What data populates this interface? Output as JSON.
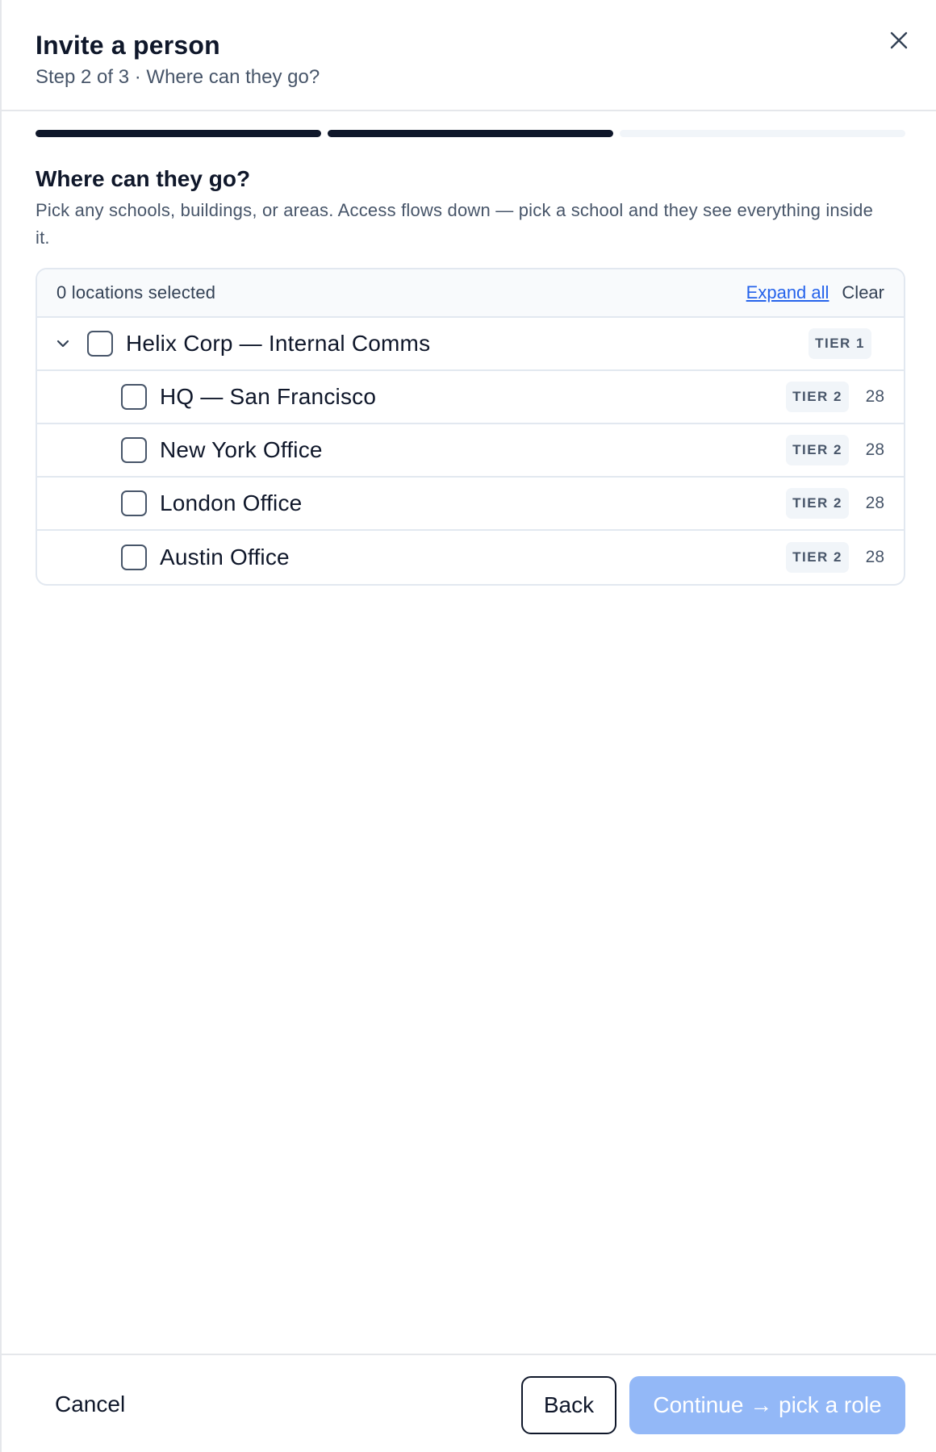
{
  "header": {
    "title": "Invite a person",
    "subtitle": "Step 2 of 3 · Where can they go?",
    "close_icon": "close-icon"
  },
  "progress": {
    "total_steps": 3,
    "completed_steps": 2
  },
  "section": {
    "title": "Where can they go?",
    "description": "Pick any schools, buildings, or areas. Access flows down — pick a school and they see everything inside it."
  },
  "tree": {
    "selected_count": "0 locations selected",
    "expand_all": "Expand all",
    "clear": "Clear",
    "root": {
      "label": "Helix Corp — Internal Comms",
      "tier": "TIER 1",
      "expanded": true,
      "checked": false
    },
    "children": [
      {
        "label": "HQ — San Francisco",
        "tier": "TIER 2",
        "count": "28",
        "checked": false
      },
      {
        "label": "New York Office",
        "tier": "TIER 2",
        "count": "28",
        "checked": false
      },
      {
        "label": "London Office",
        "tier": "TIER 2",
        "count": "28",
        "checked": false
      },
      {
        "label": "Austin Office",
        "tier": "TIER 2",
        "count": "28",
        "checked": false
      }
    ]
  },
  "footer": {
    "cancel": "Cancel",
    "back": "Back",
    "continue": "Continue → pick a role"
  },
  "colors": {
    "primary_disabled": "#93b8f7",
    "link": "#2563eb",
    "text": "#0f172a",
    "muted": "#475569"
  }
}
